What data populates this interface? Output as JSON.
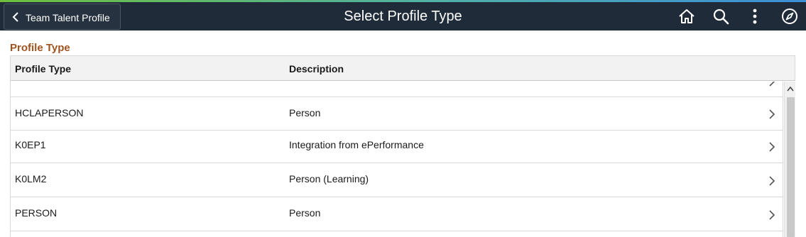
{
  "header": {
    "back_label": "Team Talent Profile",
    "title": "Select Profile Type",
    "icons": [
      "home-icon",
      "search-icon",
      "more-vertical-icon",
      "compass-icon"
    ]
  },
  "section": {
    "title": "Profile Type"
  },
  "grid": {
    "columns": [
      "Profile Type",
      "Description"
    ],
    "rows": [
      {
        "profile_type": "",
        "description": ""
      },
      {
        "profile_type": "HCLAPERSON",
        "description": "Person"
      },
      {
        "profile_type": "K0EP1",
        "description": "Integration from ePerformance"
      },
      {
        "profile_type": "K0LM2",
        "description": "Person (Learning)"
      },
      {
        "profile_type": "PERSON",
        "description": "Person"
      }
    ]
  },
  "colors": {
    "header_bg": "#1f2b38",
    "section_title": "#a0531e",
    "grid_header_bg": "#f2f2f2"
  }
}
